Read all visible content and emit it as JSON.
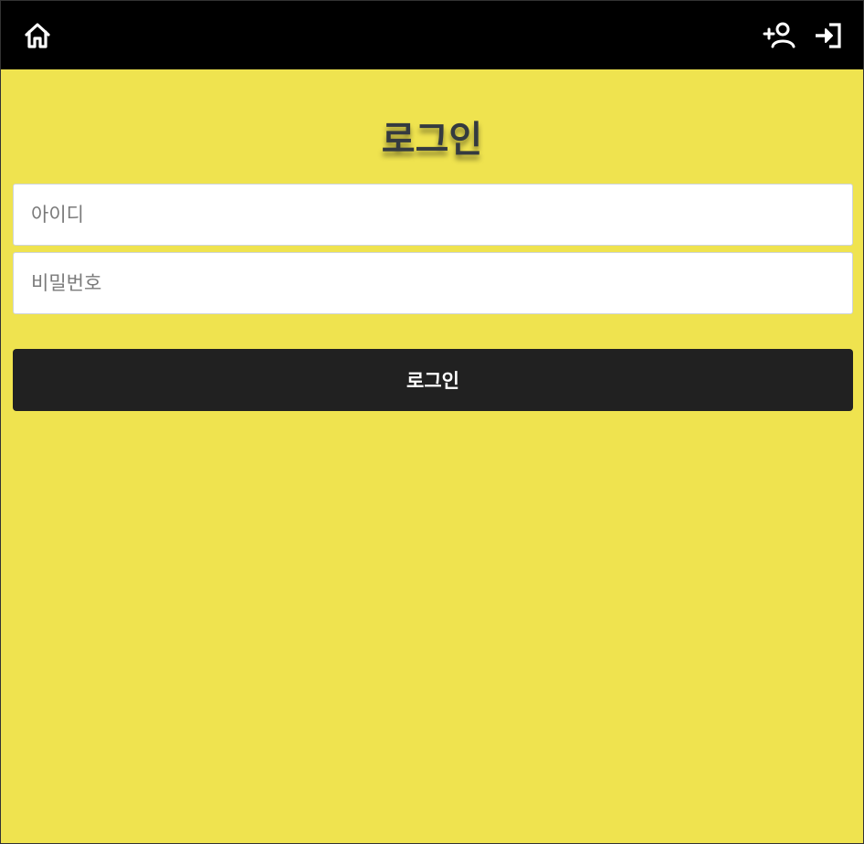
{
  "header": {
    "icons": [
      "home-icon",
      "add-user-icon",
      "sign-in-icon"
    ],
    "background": "#000000"
  },
  "main": {
    "title": "로그인",
    "background": "#efe34f",
    "username": {
      "placeholder": "아이디",
      "value": ""
    },
    "password": {
      "placeholder": "비밀번호",
      "value": ""
    },
    "submit_label": "로그인",
    "submit_color": "#212121"
  }
}
